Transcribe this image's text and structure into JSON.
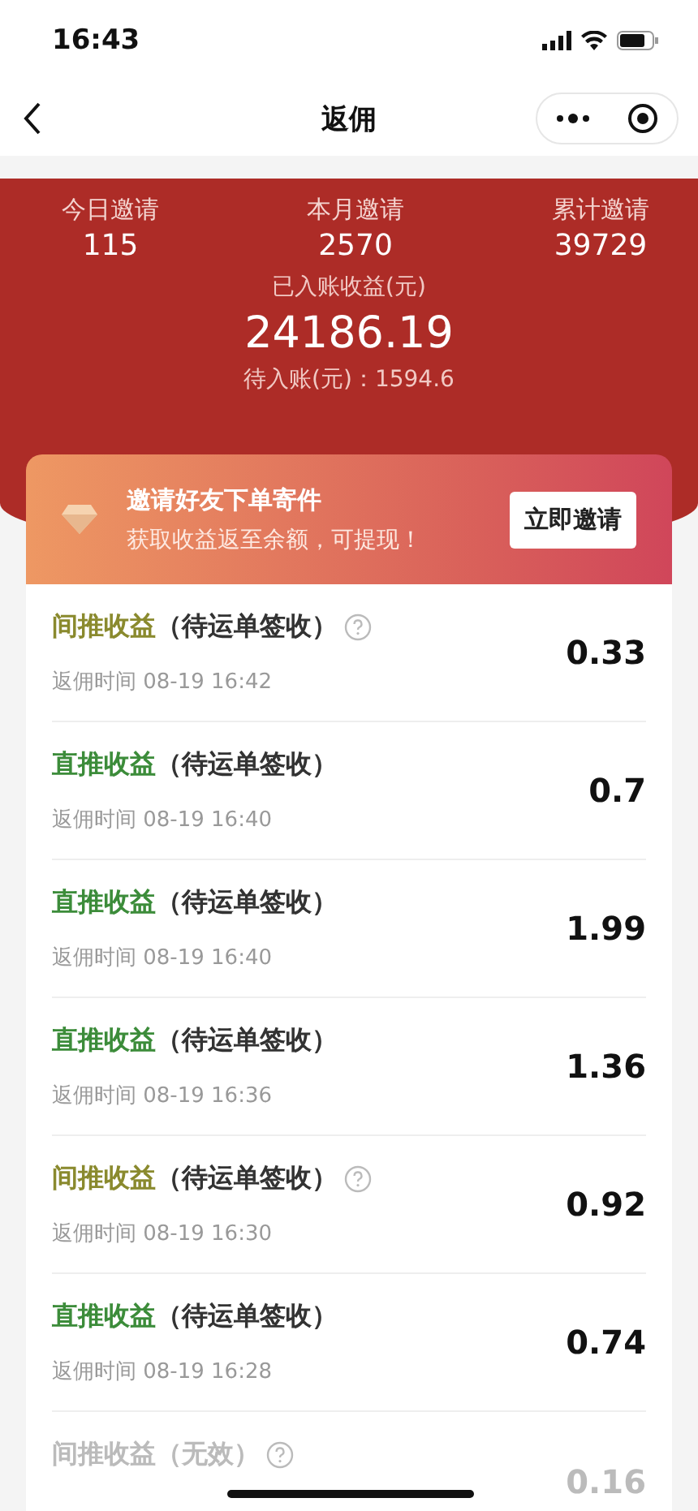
{
  "status_bar": {
    "time": "16:43"
  },
  "nav": {
    "title": "返佣"
  },
  "stats": [
    {
      "label": "今日邀请",
      "value": "115"
    },
    {
      "label": "本月邀请",
      "value": "2570"
    },
    {
      "label": "累计邀请",
      "value": "39729"
    }
  ],
  "earnings": {
    "label": "已入账收益(元)",
    "value": "24186.19",
    "pending": "待入账(元)：1594.6"
  },
  "banner": {
    "title": "邀请好友下单寄件",
    "subtitle": "获取收益返至余额，可提现！",
    "button": "立即邀请"
  },
  "records": [
    {
      "kind": "indirect",
      "type": "间推收益",
      "status": "（待运单签收）",
      "invalid": false,
      "time": "返佣时间 08-19 16:42",
      "amount": "0.33"
    },
    {
      "kind": "direct",
      "type": "直推收益",
      "status": "（待运单签收）",
      "invalid": false,
      "time": "返佣时间 08-19 16:40",
      "amount": "0.7"
    },
    {
      "kind": "direct",
      "type": "直推收益",
      "status": "（待运单签收）",
      "invalid": false,
      "time": "返佣时间 08-19 16:40",
      "amount": "1.99"
    },
    {
      "kind": "direct",
      "type": "直推收益",
      "status": "（待运单签收）",
      "invalid": false,
      "time": "返佣时间 08-19 16:36",
      "amount": "1.36"
    },
    {
      "kind": "indirect",
      "type": "间推收益",
      "status": "（待运单签收）",
      "invalid": false,
      "time": "返佣时间 08-19 16:30",
      "amount": "0.92"
    },
    {
      "kind": "direct",
      "type": "直推收益",
      "status": "（待运单签收）",
      "invalid": false,
      "time": "返佣时间 08-19 16:28",
      "amount": "0.74"
    },
    {
      "kind": "indirect",
      "type": "间推收益",
      "status": "（无效）",
      "invalid": true,
      "amount": "0.16"
    }
  ]
}
